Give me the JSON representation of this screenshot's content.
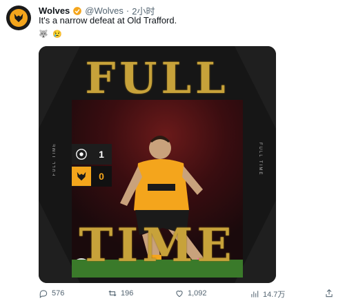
{
  "tweet": {
    "author_name": "Wolves",
    "handle": "@Wolves",
    "dot": "·",
    "time": "2小时",
    "text": "It's a narrow defeat at Old Trafford.",
    "emojis": [
      "🐺",
      "😢"
    ]
  },
  "media": {
    "headline_top": "FULL",
    "headline_bottom": "TIME",
    "side_text_left": "FULL TIME",
    "side_text_right": "FULL TIME",
    "sponsor": "astropay",
    "scores": [
      {
        "team": "Manchester United",
        "score": "1"
      },
      {
        "team": "Wolves",
        "score": "0"
      }
    ]
  },
  "actions": {
    "replies": "576",
    "retweets": "196",
    "likes": "1,092",
    "views": "14.7万"
  },
  "colors": {
    "gold": "#c7a23a",
    "wolves_orange": "#f4a51c",
    "verified": "#1d9bf0"
  }
}
